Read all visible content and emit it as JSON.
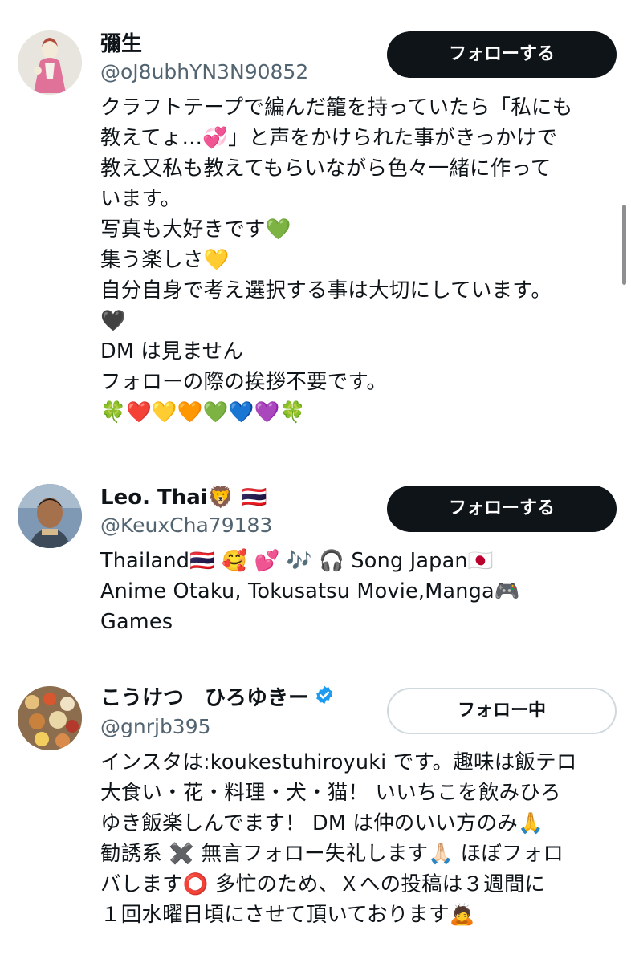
{
  "users": [
    {
      "name": "彌生",
      "handle": "@oJ8ubhYN3N90852",
      "button_label": "フォローする",
      "bio": "クラフトテープで編んだ籠を持っていたら「私にも\n教えてょ…💞」と声をかけられた事がきっかけで\n教え又私も教えてもらいながら色々一緒に作って\nいます。\n写真も大好きです💚\n集う楽しさ💛\n自分自身で考え選択する事は大切にしています。\n🖤\nDM は見ません\nフォローの際の挨拶不要です。\n🍀❤️💛🧡💚💙💜🍀"
    },
    {
      "name": "Leo. Thai🦁 🇹🇭",
      "handle": "@KeuxCha79183",
      "button_label": "フォローする",
      "bio": "Thailand🇹🇭 🥰 💕 🎶 🎧 Song Japan🇯🇵\nAnime Otaku, Tokusatsu Movie,Manga🎮\nGames"
    },
    {
      "name": "こうけつ　ひろゆきー",
      "handle": "@gnrjb395",
      "button_label": "フォロー中",
      "bio": "インスタは:koukestuhiroyuki です。趣味は飯テロ\n大食い・花・料理・犬・猫！ いいちこを飲みひろ\nゆき飯楽しんでます！ DM は仲のいい方のみ🙏\n勧誘系 ✖️ 無言フォロー失礼します🙏🏻 ほぼフォロ\nバします⭕️ 多忙のため、Ｘへの投稿は３週間に\n１回水曜日頃にさせて頂いております🙇"
    }
  ],
  "colors": {
    "follow_button": "#0f1419",
    "verified_badge": "#1d9bf0",
    "handle_text": "#536471"
  }
}
